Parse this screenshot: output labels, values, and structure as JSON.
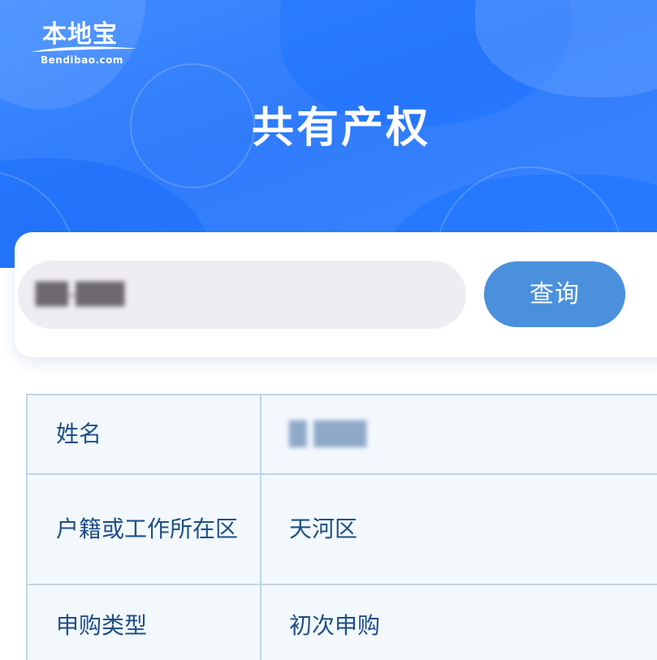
{
  "header": {
    "logo_cn": "本地宝",
    "logo_en": "Bendibao.com",
    "title": "共有产权"
  },
  "search": {
    "input_value": "██-███",
    "button_label": "查询"
  },
  "result": {
    "rows": [
      {
        "label": "姓名",
        "value": "█ ███"
      },
      {
        "label": "户籍或工作所在区",
        "value": "天河区"
      },
      {
        "label": "申购类型",
        "value": "初次申购"
      }
    ]
  },
  "colors": {
    "hero_blue": "#2f7bfb",
    "button_blue": "#4a90dd",
    "input_bg": "#efedf1",
    "table_border": "#bfd5e6",
    "table_bg": "#f3f8fd",
    "table_text": "#1e4f86"
  }
}
